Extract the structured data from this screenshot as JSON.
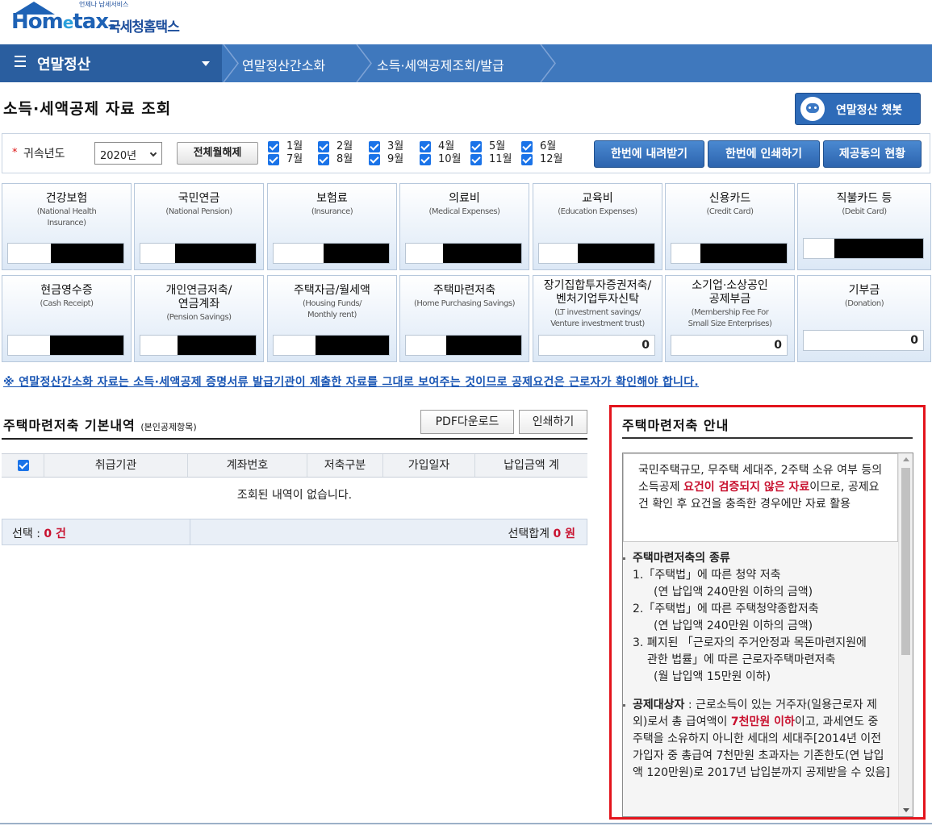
{
  "logo": {
    "small_text": "언제나 납세서비스",
    "brand_main": "Hom",
    "brand_e": "e",
    "brand_tail": "tax.",
    "brand_kr": "국세청홈택스"
  },
  "nav": {
    "main_title": "연말정산",
    "crumbs": [
      "연말정산간소화",
      "소득·세액공제조회/발급"
    ]
  },
  "page": {
    "title": "소득·세액공제 자료 조회",
    "chatbot_label": "연말정산 챗봇"
  },
  "filter": {
    "required_mark": "*",
    "year_label": "귀속년도",
    "year_value": "2020년",
    "deselect_all": "전체월해제",
    "months_row1": [
      "1월",
      "2월",
      "3월",
      "4월",
      "5월",
      "6월"
    ],
    "months_row2": [
      "7월",
      "8월",
      "9월",
      "10월",
      "11월",
      "12월"
    ],
    "download_all": "한번에 내려받기",
    "print_all": "한번에 인쇄하기",
    "provider_status": "제공동의 현황"
  },
  "cards": [
    {
      "kr": "건강보험",
      "en1": "(National Health",
      "en2": "Insurance)",
      "value": ""
    },
    {
      "kr": "국민연금",
      "en1": "(National Pension)",
      "en2": "",
      "value": ""
    },
    {
      "kr": "보험료",
      "en1": "(Insurance)",
      "en2": "",
      "value": ""
    },
    {
      "kr": "의료비",
      "en1": "(Medical Expenses)",
      "en2": "",
      "value": ""
    },
    {
      "kr": "교육비",
      "en1": "(Education Expenses)",
      "en2": "",
      "value": ""
    },
    {
      "kr": "신용카드",
      "en1": "(Credit Card)",
      "en2": "",
      "value": ""
    },
    {
      "kr": "직불카드 등",
      "en1": "(Debit Card)",
      "en2": "",
      "value": ""
    },
    {
      "kr": "현금영수증",
      "en1": "(Cash Receipt)",
      "en2": "",
      "value": ""
    },
    {
      "kr": "개인연금저축/",
      "kr2": "연금계좌",
      "en1": "(Pension Savings)",
      "en2": "",
      "value": ""
    },
    {
      "kr": "주택자금/월세액",
      "en1": "(Housing Funds/",
      "en2": "Monthly rent)",
      "value": ""
    },
    {
      "kr": "주택마련저축",
      "en1": "(Home Purchasing Savings)",
      "en2": "",
      "value": ""
    },
    {
      "kr": "장기집합투자증권저축/",
      "kr2": "벤처기업투자신탁",
      "en1": "(LT investment savings/",
      "en2": "Venture investment trust)",
      "value": "0"
    },
    {
      "kr": "소기업·소상공인",
      "kr2": "공제부금",
      "en1": "(Membership Fee For",
      "en2": "Small Size Enterprises)",
      "value": "0"
    },
    {
      "kr": "기부금",
      "en1": "(Donation)",
      "en2": "",
      "value": "0"
    }
  ],
  "notice": "※ 연말정산간소화 자료는 소득·세액공제 증명서류 발급기관이 제출한 자료를 그대로 보여주는 것이므로 공제요건은 근로자가 확인해야 합니다.",
  "section": {
    "title": "주택마련저축 기본내역",
    "title_note": "(본인공제항목)",
    "pdf_download": "PDF다운로드",
    "print": "인쇄하기",
    "columns": [
      "취급기관",
      "계좌번호",
      "저축구분",
      "가입일자",
      "납입금액 계"
    ],
    "empty_message": "조회된 내역이 없습니다.",
    "selected_label": "선택 :",
    "selected_count": "0 건",
    "selected_total_label": "선택합계",
    "selected_total": "0 원"
  },
  "guide": {
    "title": "주택마련저축 안내",
    "box_pre": "국민주택규모, 무주택 세대주, 2주택 소유 여부 등의 소득공제",
    "box_highlight": "요건이 검증되지 않은 자료",
    "box_post": "이므로, 공제요건 확인 후 요건을 충족한 경우에만 자료 활용",
    "types_title": "주택마련저축의 종류",
    "type1": "1.「주택법」에 따른 청약 저축",
    "type1_sub": "(연 납입액 240만원 이하의 금액)",
    "type2": "2.「주택법」에 따른 주택청약종합저축",
    "type2_sub": "(연 납입액 240만원 이하의 금액)",
    "type3a": "3. 폐지된 「근로자의 주거안정과 목돈마련지원에",
    "type3b": "관한 법률」에 따른 근로자주택마련저축",
    "type3_sub": "(월 납입액 15만원 이하)",
    "target_title": "공제대상자",
    "target_pre": ": 근로소득이 있는 거주자(일용근로자 제외)로서 총 급여액이",
    "target_highlight": "7천만원 이하",
    "target_post": "이고, 과세연도 중 주택을 소유하지 아니한 세대의 세대주[2014년 이전 가입자 중 총급여 7천만원 초과자는 기존한도(연 납입액 120만원)로 2017년 납입분까지 공제받을 수 있음]"
  }
}
